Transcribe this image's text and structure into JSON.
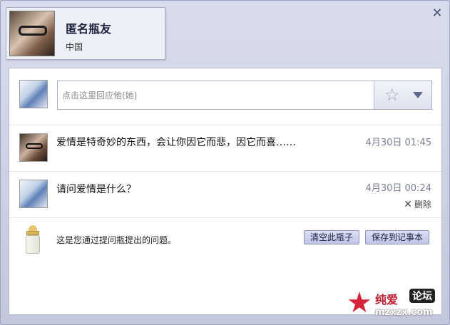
{
  "profile": {
    "name": "匿名瓶友",
    "location": "中国"
  },
  "reply": {
    "placeholder": "点击这里回应他(她)",
    "value": ""
  },
  "messages": [
    {
      "text": "爱情是特奇妙的东西，会让你因它而悲，因它而喜……",
      "time": "4月30日 01:45",
      "avatar": "girl-avatar"
    },
    {
      "text": "请问爱情是什么？",
      "time": "4月30日 00:24",
      "avatar": "anime-avatar",
      "delete_label": "删除"
    }
  ],
  "footer": {
    "text": "这是您通过提问瓶提出的问题。",
    "clear_button": "清空此瓶子",
    "save_button": "保存到记事本"
  },
  "watermark": {
    "title": "纯爱",
    "badge": "论坛",
    "url": "mzxzx.com"
  },
  "icons": {
    "close": "close-icon",
    "emote": "magic-wand-icon",
    "bottle": "baby-bottle-icon",
    "watermark_star": "star-logo-icon"
  }
}
